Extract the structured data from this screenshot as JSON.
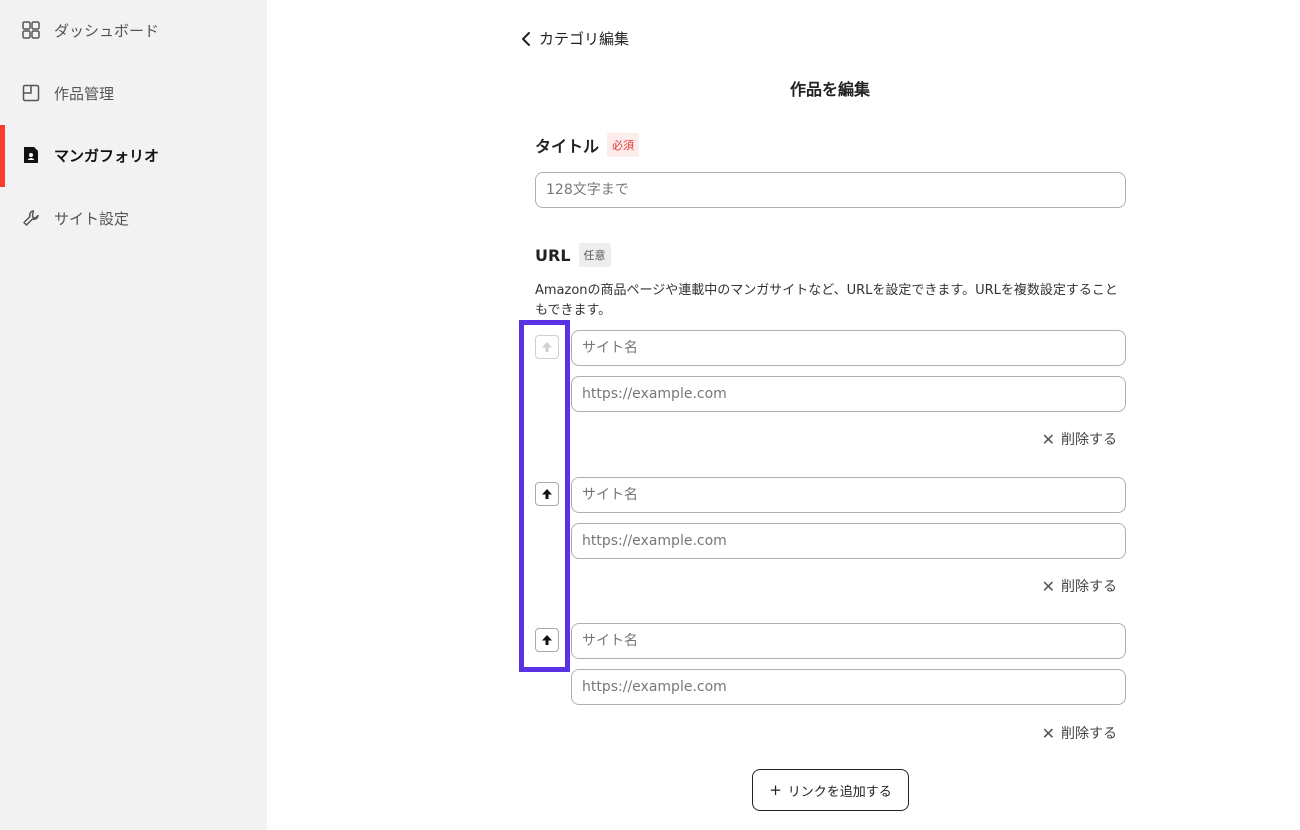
{
  "sidebar": {
    "items": [
      {
        "label": "ダッシュボード",
        "icon": "grid-icon"
      },
      {
        "label": "作品管理",
        "icon": "layout-icon"
      },
      {
        "label": "マンガフォリオ",
        "icon": "profile-doc-icon",
        "active": true
      },
      {
        "label": "サイト設定",
        "icon": "wrench-icon"
      }
    ],
    "accent_color": "#ff3b30"
  },
  "header": {
    "back_label": "カテゴリ編集",
    "title": "作品を編集"
  },
  "title_field": {
    "label": "タイトル",
    "badge": "必須",
    "placeholder": "128文字まで",
    "value": ""
  },
  "url_field": {
    "label": "URL",
    "badge": "任意",
    "help": "Amazonの商品ページや連載中のマンガサイトなど、URLを設定できます。URLを複数設定することもできます。",
    "entries": [
      {
        "name_placeholder": "サイト名",
        "url_placeholder": "https://example.com",
        "delete_label": "削除する",
        "up_enabled": false
      },
      {
        "name_placeholder": "サイト名",
        "url_placeholder": "https://example.com",
        "delete_label": "削除する",
        "up_enabled": true
      },
      {
        "name_placeholder": "サイト名",
        "url_placeholder": "https://example.com",
        "delete_label": "削除する",
        "up_enabled": true
      }
    ],
    "add_label": "リンクを追加する"
  },
  "highlight_color": "#5a32e6"
}
